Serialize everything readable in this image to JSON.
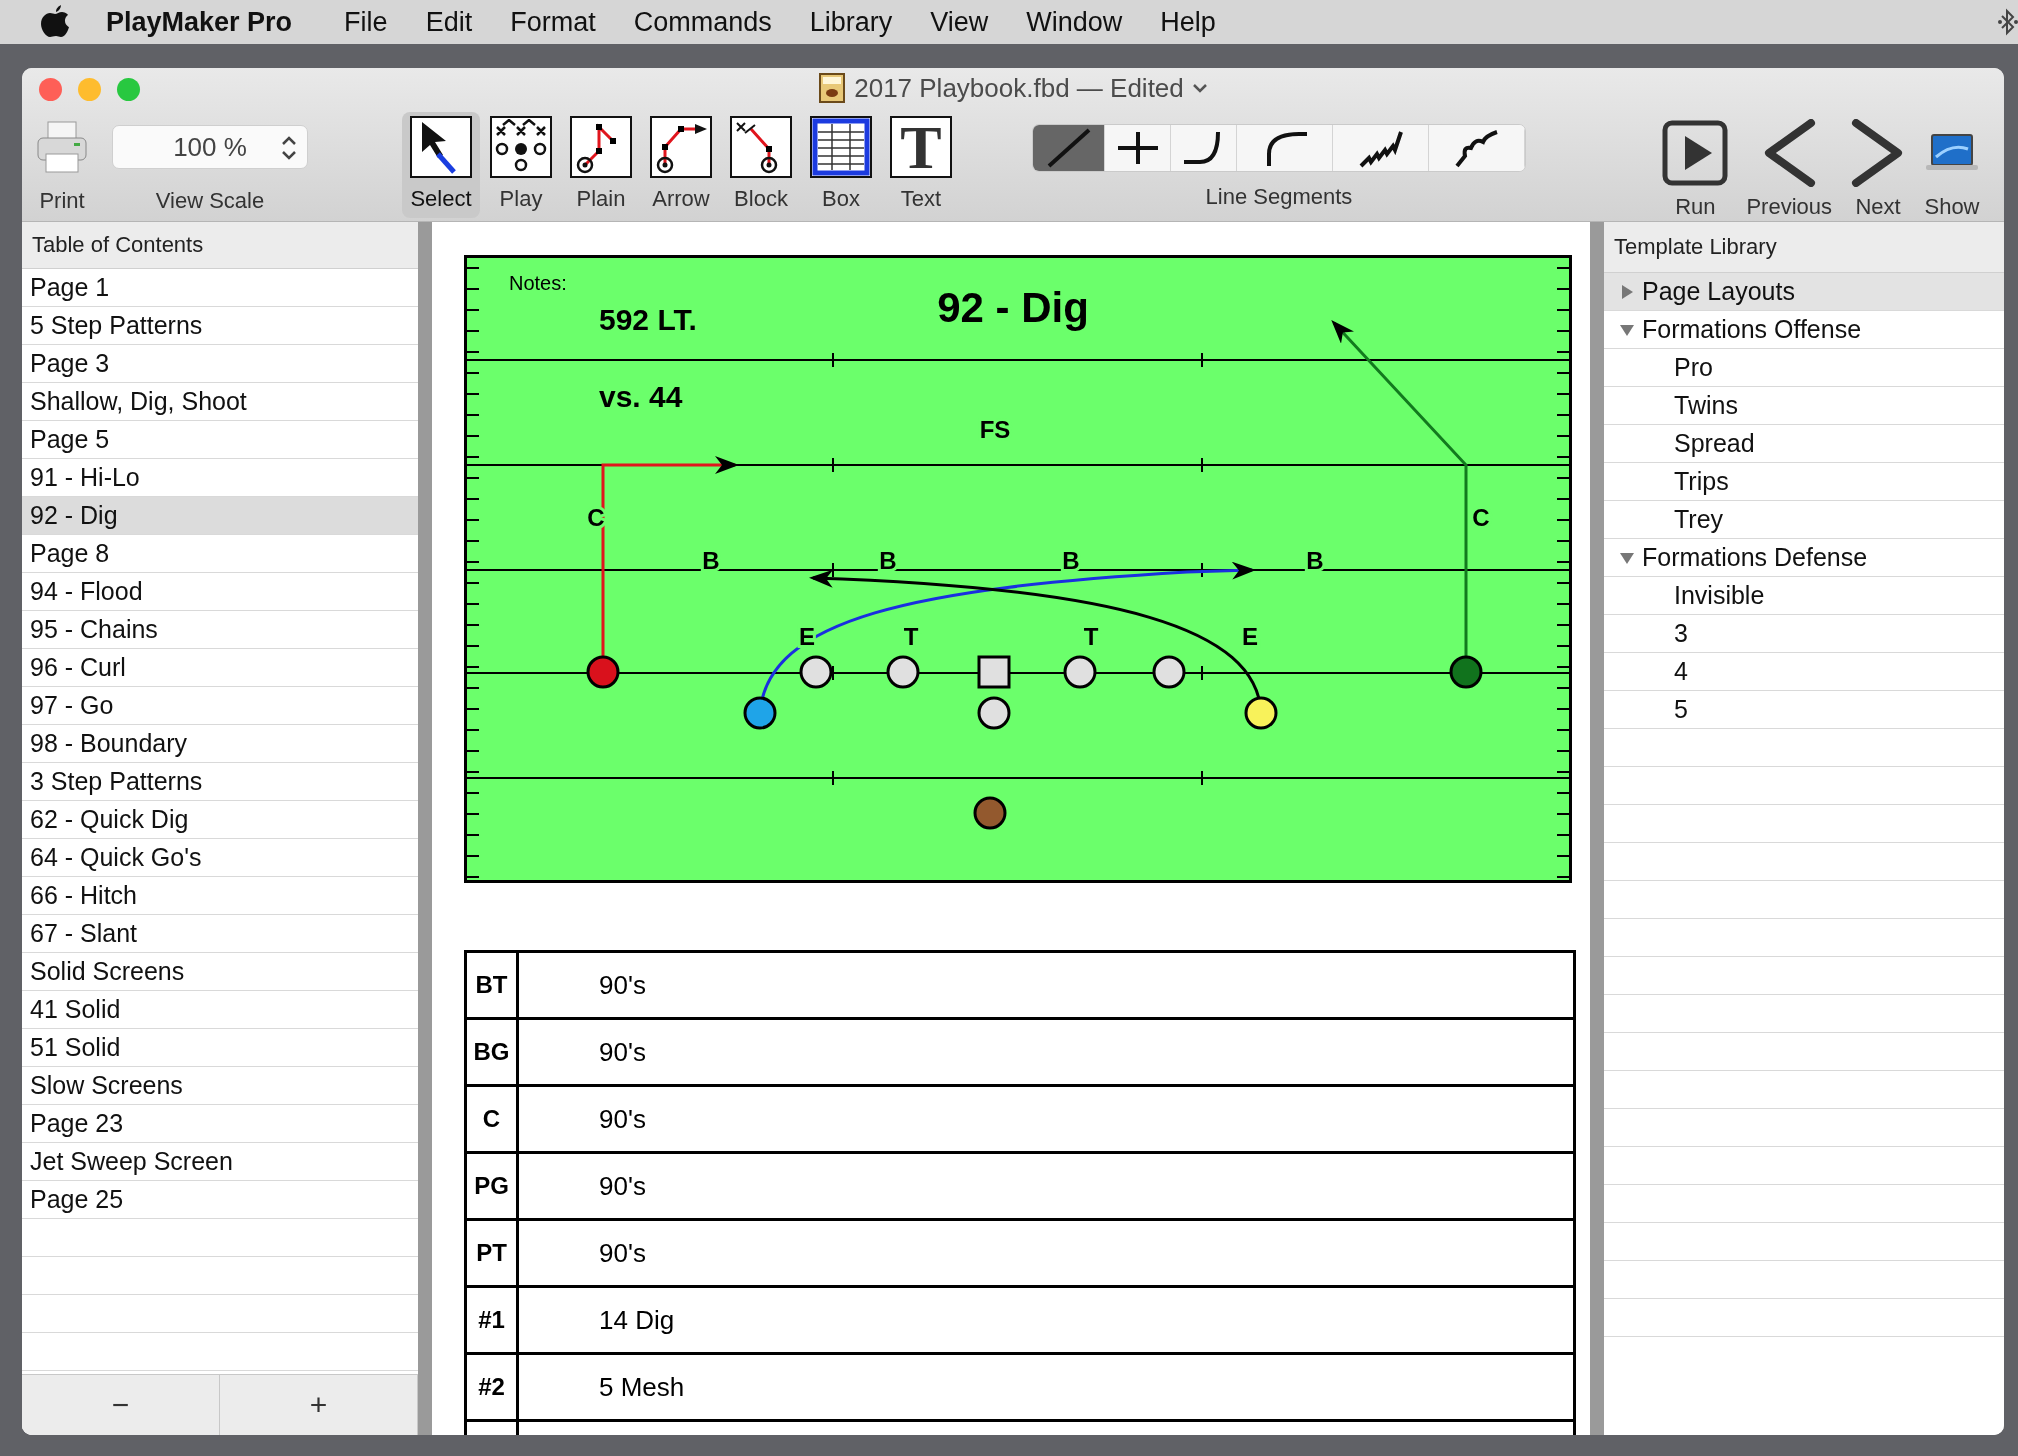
{
  "menu_bar": {
    "app_name": "PlayMaker Pro",
    "items": [
      "File",
      "Edit",
      "Format",
      "Commands",
      "Library",
      "View",
      "Window",
      "Help"
    ]
  },
  "window": {
    "title": "2017 Playbook.fbd — Edited"
  },
  "toolbar": {
    "print": "Print",
    "view_scale": {
      "value": "100 %",
      "label": "View Scale"
    },
    "tools": [
      {
        "label": "Select",
        "selected": true
      },
      {
        "label": "Play",
        "selected": false
      },
      {
        "label": "Plain",
        "selected": false
      },
      {
        "label": "Arrow",
        "selected": false
      },
      {
        "label": "Block",
        "selected": false
      },
      {
        "label": "Box",
        "selected": false
      },
      {
        "label": "Text",
        "selected": false,
        "glyph": "T"
      }
    ],
    "line_segments": {
      "label": "Line Segments",
      "segments": [
        {
          "kind": "straight",
          "selected": true
        },
        {
          "kind": "cross",
          "selected": false
        },
        {
          "kind": "hook",
          "selected": false
        },
        {
          "kind": "arc",
          "selected": false
        },
        {
          "kind": "zigzag",
          "selected": false
        },
        {
          "kind": "loop",
          "selected": false
        }
      ]
    },
    "navigation": [
      "Run",
      "Previous",
      "Next",
      "Show"
    ]
  },
  "table_of_contents": {
    "title": "Table of Contents",
    "items": [
      {
        "label": "Page 1",
        "selected": false
      },
      {
        "label": "5 Step Patterns",
        "selected": false
      },
      {
        "label": "Page 3",
        "selected": false
      },
      {
        "label": "Shallow, Dig, Shoot",
        "selected": false
      },
      {
        "label": "Page 5",
        "selected": false
      },
      {
        "label": "91 - Hi-Lo",
        "selected": false
      },
      {
        "label": "92 - Dig",
        "selected": true
      },
      {
        "label": "Page 8",
        "selected": false
      },
      {
        "label": "94 - Flood",
        "selected": false
      },
      {
        "label": "95 - Chains",
        "selected": false
      },
      {
        "label": "96 - Curl",
        "selected": false
      },
      {
        "label": "97 - Go",
        "selected": false
      },
      {
        "label": "98 - Boundary",
        "selected": false
      },
      {
        "label": "3 Step Patterns",
        "selected": false
      },
      {
        "label": "62 - Quick Dig",
        "selected": false
      },
      {
        "label": "64 - Quick Go's",
        "selected": false
      },
      {
        "label": "66 - Hitch",
        "selected": false
      },
      {
        "label": "67 - Slant",
        "selected": false
      },
      {
        "label": "Solid Screens",
        "selected": false
      },
      {
        "label": "41 Solid",
        "selected": false
      },
      {
        "label": "51 Solid",
        "selected": false
      },
      {
        "label": "Slow Screens",
        "selected": false
      },
      {
        "label": "Page 23",
        "selected": false
      },
      {
        "label": "Jet Sweep Screen",
        "selected": false
      },
      {
        "label": "Page 25",
        "selected": false
      }
    ],
    "buttons": [
      "−",
      "+"
    ]
  },
  "play": {
    "notes_label": "Notes:",
    "title": "92 - Dig",
    "notes": [
      "592 LT.",
      "vs. 44"
    ],
    "labels": [
      "FS",
      "C",
      "C",
      "B",
      "B",
      "B",
      "B",
      "E",
      "T",
      "T",
      "E"
    ],
    "players": [
      {
        "kind": "circle",
        "color": "#d9111c"
      },
      {
        "kind": "circle",
        "color": "#e0e0e0"
      },
      {
        "kind": "circle",
        "color": "#e0e0e0"
      },
      {
        "kind": "square",
        "color": "#e0e0e0"
      },
      {
        "kind": "circle",
        "color": "#e0e0e0"
      },
      {
        "kind": "circle",
        "color": "#e0e0e0"
      },
      {
        "kind": "circle",
        "color": "#11731d"
      },
      {
        "kind": "circle",
        "color": "#1fa4e8"
      },
      {
        "kind": "circle",
        "color": "#e0e0e0"
      },
      {
        "kind": "circle",
        "color": "#f8f25a"
      },
      {
        "kind": "circle",
        "color": "#93592e"
      }
    ]
  },
  "assignments": {
    "rows": [
      {
        "position": "BT",
        "assignment": "90's"
      },
      {
        "position": "BG",
        "assignment": "90's"
      },
      {
        "position": "C",
        "assignment": "90's"
      },
      {
        "position": "PG",
        "assignment": "90's"
      },
      {
        "position": "PT",
        "assignment": "90's"
      },
      {
        "position": "#1",
        "assignment": "14 Dig"
      },
      {
        "position": "#2",
        "assignment": "5 Mesh"
      }
    ]
  },
  "template_library": {
    "title": "Template Library",
    "items": [
      {
        "label": "Page Layouts",
        "expanded": false,
        "selected": true
      },
      {
        "label": "Formations Offense",
        "expanded": true,
        "selected": false,
        "children": [
          {
            "label": "Pro",
            "selected": false
          },
          {
            "label": "Twins",
            "selected": false
          },
          {
            "label": "Spread",
            "selected": false
          },
          {
            "label": "Trips",
            "selected": false
          },
          {
            "label": "Trey",
            "selected": false
          }
        ]
      },
      {
        "label": "Formations Defense",
        "expanded": true,
        "selected": false,
        "children": [
          {
            "label": "Invisible",
            "selected": false
          },
          {
            "label": "3",
            "selected": false
          },
          {
            "label": "4",
            "selected": false
          },
          {
            "label": "5",
            "selected": false
          }
        ]
      }
    ]
  }
}
